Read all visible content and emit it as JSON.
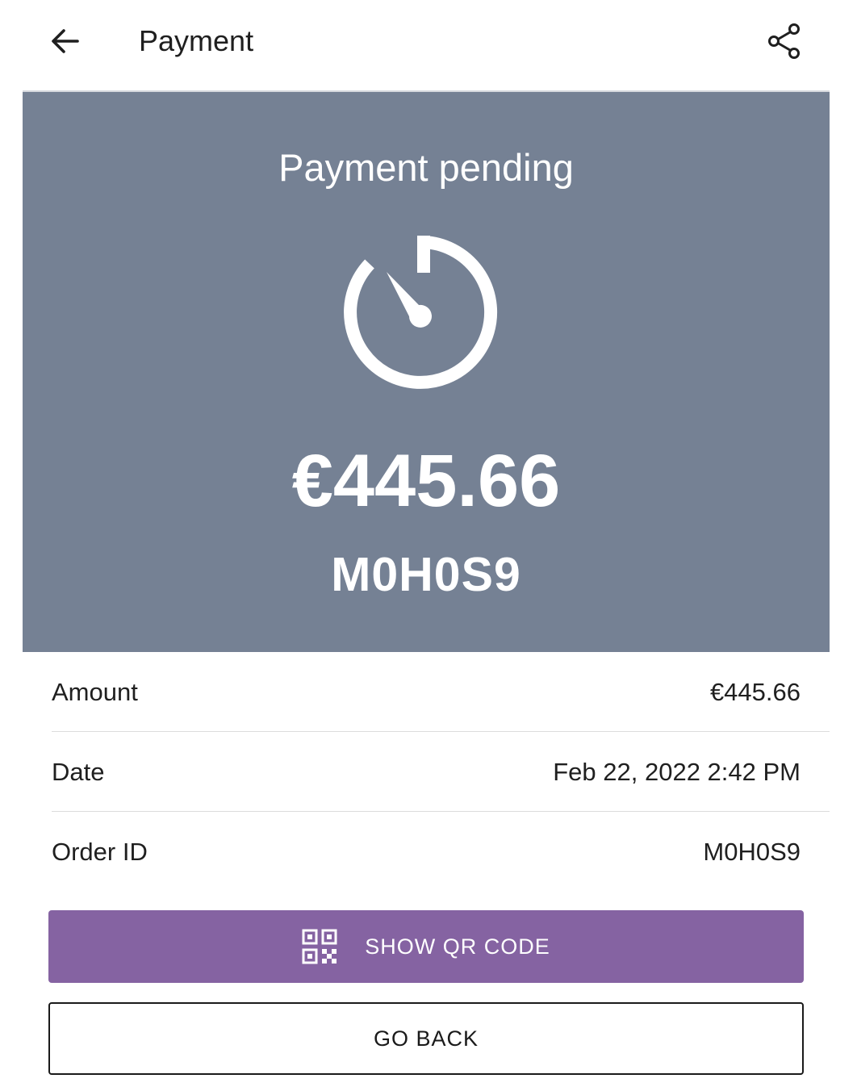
{
  "header": {
    "title": "Payment",
    "back_icon": "arrow-left-icon",
    "share_icon": "share-icon"
  },
  "hero": {
    "status": "Payment pending",
    "status_icon": "timer-icon",
    "amount": "€445.66",
    "order_code": "M0H0S9",
    "background_color": "#758194"
  },
  "details": [
    {
      "label": "Amount",
      "value": "€445.66"
    },
    {
      "label": "Date",
      "value": "Feb 22, 2022 2:42 PM"
    },
    {
      "label": "Order ID",
      "value": "M0H0S9"
    }
  ],
  "actions": {
    "show_qr_label": "SHOW QR CODE",
    "show_qr_icon": "qr-code-icon",
    "show_qr_color": "#8563a2",
    "go_back_label": "GO BACK"
  }
}
